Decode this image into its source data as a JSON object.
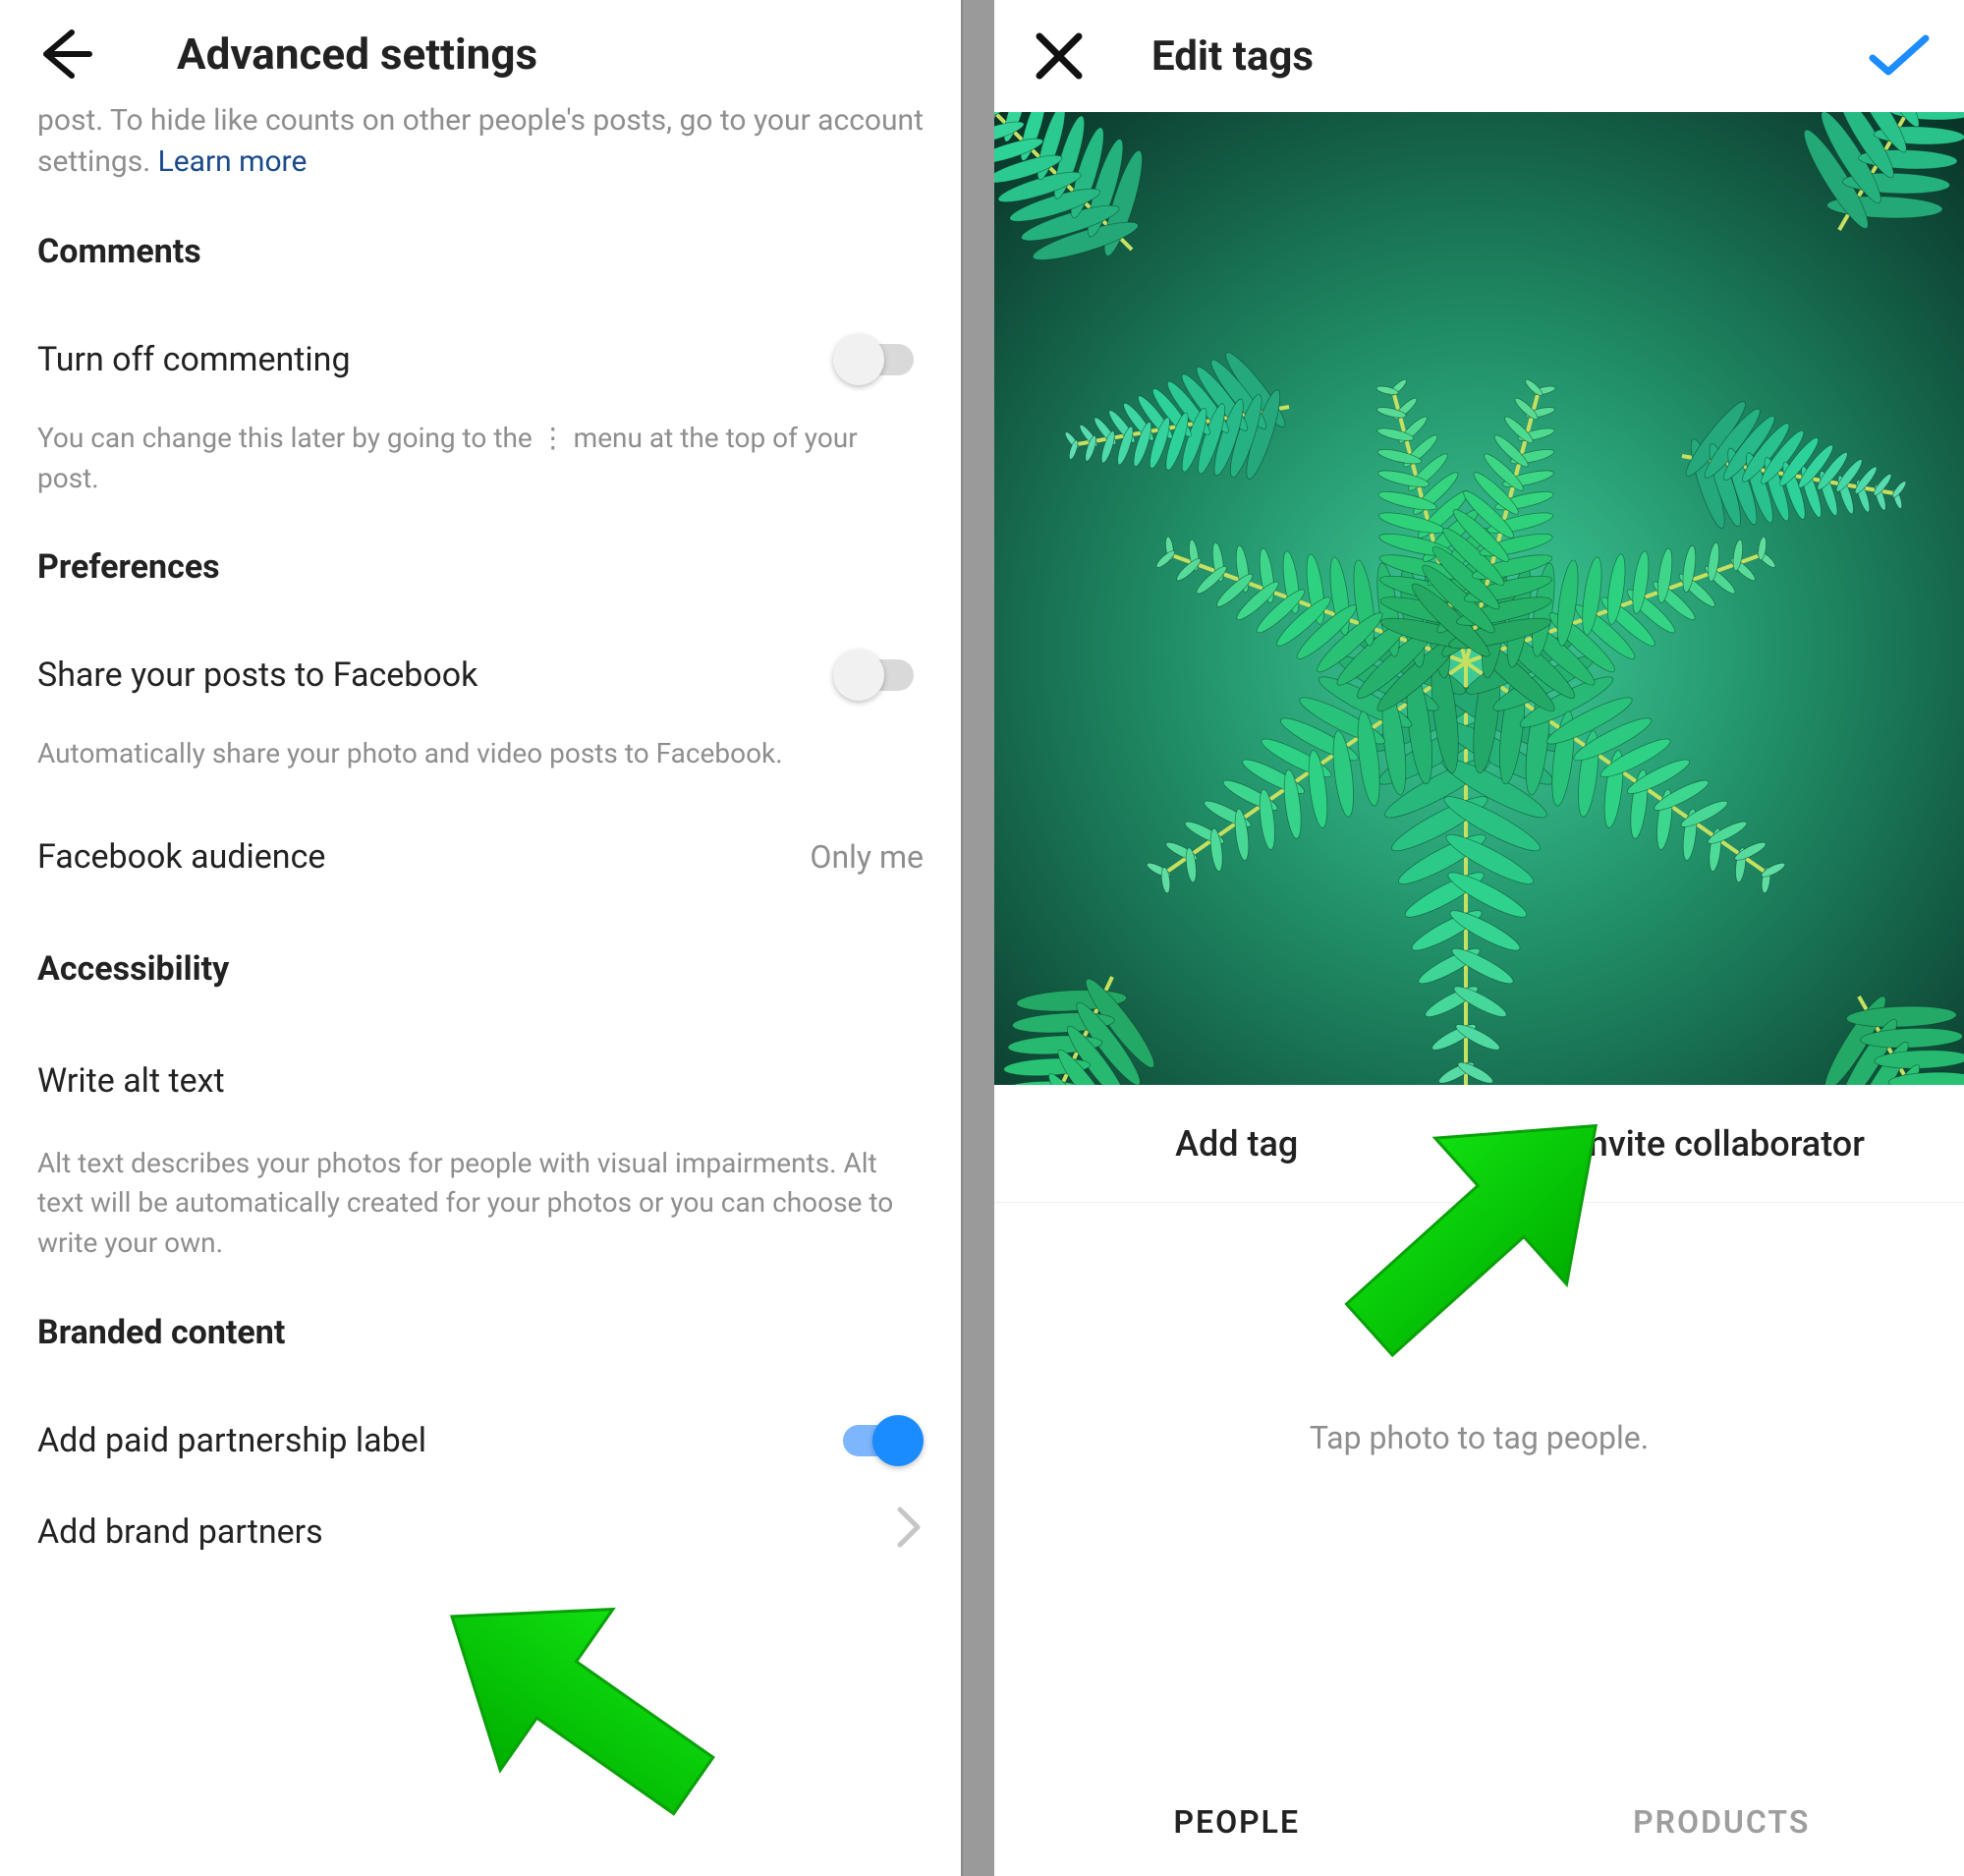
{
  "left": {
    "title": "Advanced settings",
    "cutoff_desc_prefix": "post. To hide like counts on other people's posts, go to your account settings. ",
    "learn_more": "Learn more",
    "sections": {
      "comments": {
        "heading": "Comments",
        "toggle_label": "Turn off commenting",
        "toggle_on": false,
        "desc": "You can change this later by going to the ⋮ menu at the top of your post."
      },
      "preferences": {
        "heading": "Preferences",
        "share_label": "Share your posts to Facebook",
        "share_on": false,
        "share_desc": "Automatically share your photo and video posts to Facebook.",
        "audience_label": "Facebook audience",
        "audience_value": "Only me"
      },
      "accessibility": {
        "heading": "Accessibility",
        "alt_label": "Write alt text",
        "alt_desc": "Alt text describes your photos for people with visual impairments. Alt text will be automatically created for your photos or you can choose to write your own."
      },
      "branded": {
        "heading": "Branded content",
        "paid_label": "Add paid partnership label",
        "paid_on": true,
        "partners_label": "Add brand partners"
      }
    }
  },
  "right": {
    "title": "Edit tags",
    "add_tag": "Add tag",
    "invite_collab": "Invite collaborator",
    "tap_hint": "Tap photo to tag people.",
    "tabs": {
      "people": "PEOPLE",
      "products": "PRODUCTS"
    }
  }
}
